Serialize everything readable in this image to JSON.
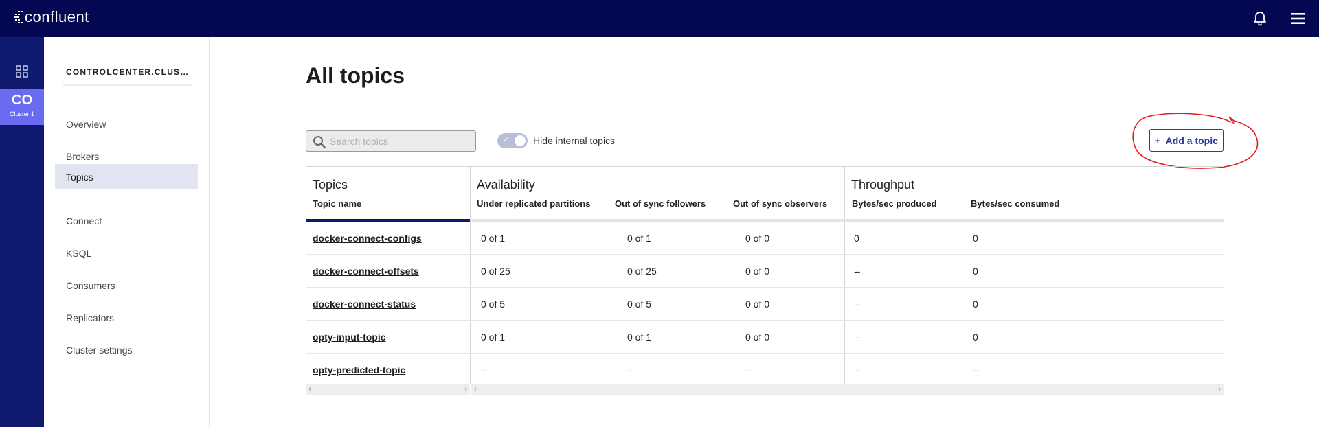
{
  "brand": {
    "logo_text": "confluent"
  },
  "rail": {
    "cluster_abbr": "CO",
    "cluster_label": "Cluster 1"
  },
  "sidebar": {
    "cluster_name": "CONTROLCENTER.CLUSTER",
    "items": [
      {
        "label": "Overview",
        "active": false
      },
      {
        "label": "Brokers",
        "active": false
      },
      {
        "label": "Topics",
        "active": true
      },
      {
        "label": "Connect",
        "active": false
      },
      {
        "label": "KSQL",
        "active": false
      },
      {
        "label": "Consumers",
        "active": false
      },
      {
        "label": "Replicators",
        "active": false
      },
      {
        "label": "Cluster settings",
        "active": false
      }
    ]
  },
  "main": {
    "title": "All topics",
    "search": {
      "placeholder": "Search topics",
      "value": ""
    },
    "toggle": {
      "label": "Hide internal topics",
      "checked": true
    },
    "add_button": {
      "icon": "+",
      "label": "Add a topic"
    }
  },
  "table": {
    "groups": [
      "Topics",
      "Availability",
      "Throughput"
    ],
    "columns": [
      "Topic name",
      "Under replicated partitions",
      "Out of sync followers",
      "Out of sync observers",
      "Bytes/sec produced",
      "Bytes/sec consumed"
    ],
    "rows": [
      [
        "docker-connect-configs",
        "0 of 1",
        "0 of 1",
        "0 of 0",
        "0",
        "0"
      ],
      [
        "docker-connect-offsets",
        "0 of 25",
        "0 of 25",
        "0 of 0",
        "--",
        "0"
      ],
      [
        "docker-connect-status",
        "0 of 5",
        "0 of 5",
        "0 of 0",
        "--",
        "0"
      ],
      [
        "opty-input-topic",
        "0 of 1",
        "0 of 1",
        "0 of 0",
        "--",
        "0"
      ],
      [
        "opty-predicted-topic",
        "--",
        "--",
        "--",
        "--",
        "--"
      ]
    ]
  },
  "colors": {
    "topbar": "#040752",
    "rail": "#0d1a6e",
    "cluster_tile": "#6a6bf0",
    "accent": "#2b3c9a",
    "annotation": "#e01b1b"
  }
}
